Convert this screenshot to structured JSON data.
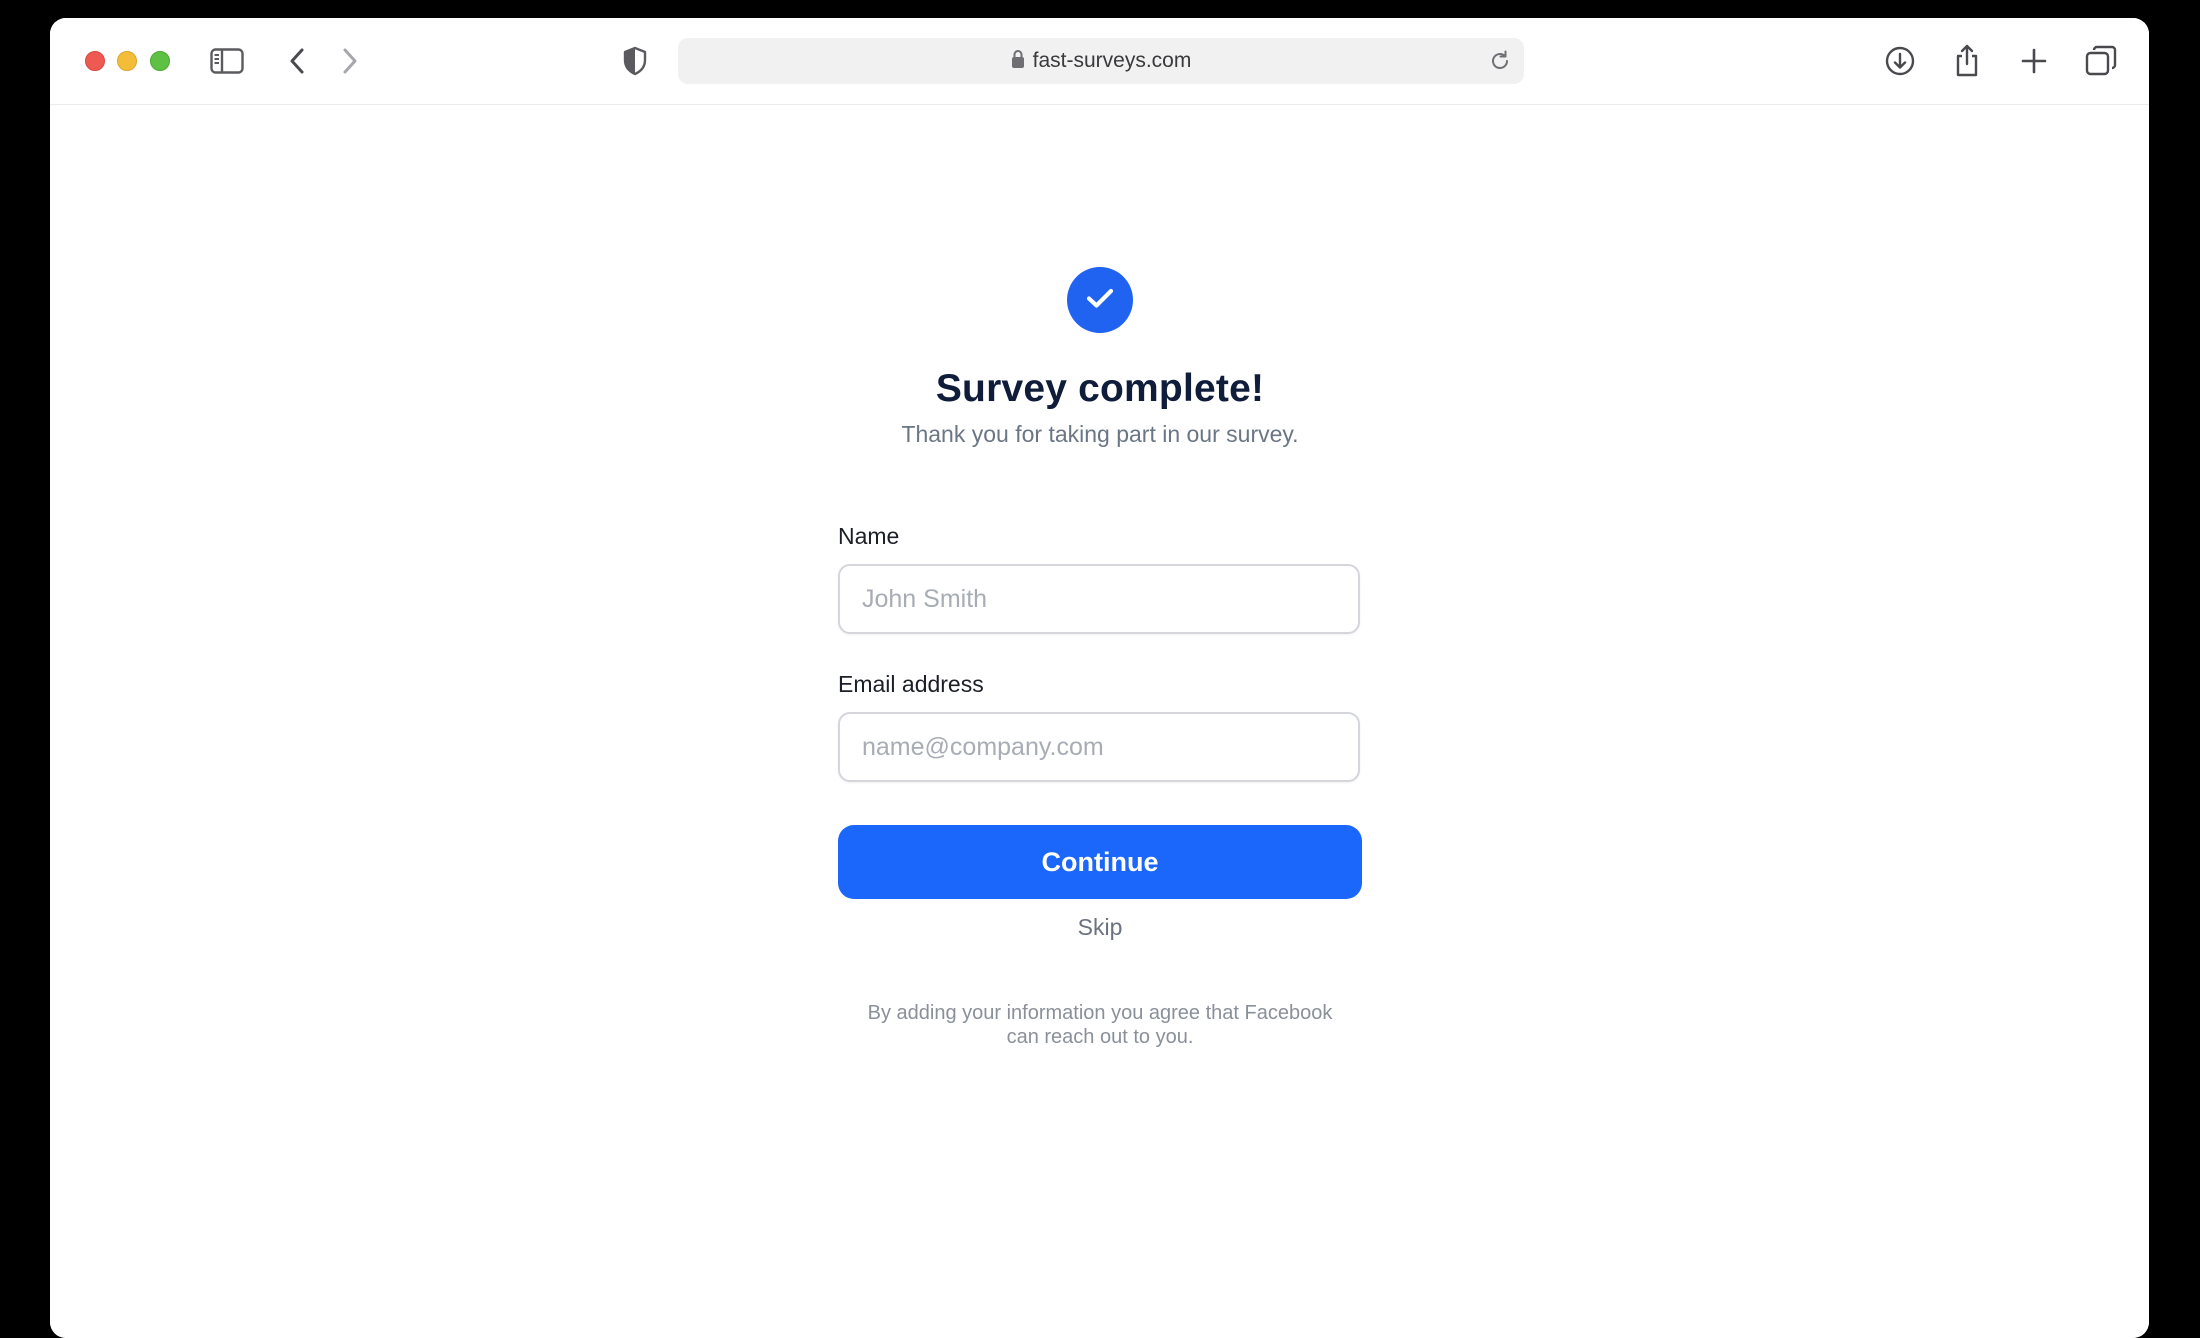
{
  "browser": {
    "url": "fast-surveys.com",
    "icons": {
      "sidebar": "sidebar-icon",
      "back": "chevron-left-icon",
      "forward": "chevron-right-icon",
      "privacy": "shield-icon",
      "lock": "lock-icon",
      "reload": "reload-icon",
      "downloads": "download-icon",
      "share": "share-icon",
      "new_tab": "plus-icon",
      "tabs": "tabs-overview-icon"
    }
  },
  "survey": {
    "title": "Survey complete!",
    "subtitle": "Thank you for taking part in our survey.",
    "name_label": "Name",
    "name_placeholder": "John Smith",
    "name_value": "",
    "email_label": "Email address",
    "email_placeholder": "name@company.com",
    "email_value": "",
    "continue_label": "Continue",
    "skip_label": "Skip",
    "disclaimer_line1": "By adding your information you agree that Facebook",
    "disclaimer_line2": "can reach out to you."
  },
  "colors": {
    "accent": "#1b66fb",
    "badge": "#1f63f0",
    "title": "#0f1d3a",
    "muted": "#6b7685"
  }
}
